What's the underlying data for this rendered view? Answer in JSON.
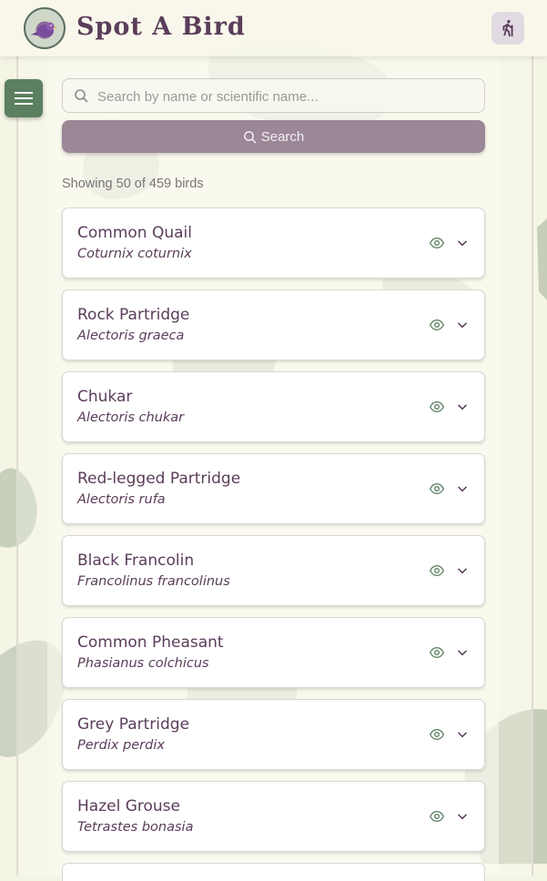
{
  "app": {
    "title": "Spot A Bird",
    "logo_text": "Spot A Bird"
  },
  "header": {
    "menu_icon": "hamburger-menu-icon",
    "right_icon": "hiking-icon"
  },
  "search": {
    "placeholder": "Search by name or scientific name...",
    "value": "",
    "button_label": "Search",
    "icon": "search-icon"
  },
  "results": {
    "summary": "Showing 50 of 459 birds",
    "birds": [
      {
        "name": "Common Quail",
        "scientific": "Coturnix coturnix"
      },
      {
        "name": "Rock Partridge",
        "scientific": "Alectoris graeca"
      },
      {
        "name": "Chukar",
        "scientific": "Alectoris chukar"
      },
      {
        "name": "Red-legged Partridge",
        "scientific": "Alectoris rufa"
      },
      {
        "name": "Black Francolin",
        "scientific": "Francolinus francolinus"
      },
      {
        "name": "Common Pheasant",
        "scientific": "Phasianus colchicus"
      },
      {
        "name": "Grey Partridge",
        "scientific": "Perdix perdix"
      },
      {
        "name": "Hazel Grouse",
        "scientific": "Tetrastes bonasia"
      }
    ],
    "card_icons": [
      "eye-icon",
      "chevron-down-icon"
    ]
  },
  "colors": {
    "background": "#f5f5e6",
    "primary_text": "#5a3d5a",
    "menu_button": "#5b7f60",
    "search_button": "#9b8796",
    "accent_green": "#5b7f60"
  }
}
